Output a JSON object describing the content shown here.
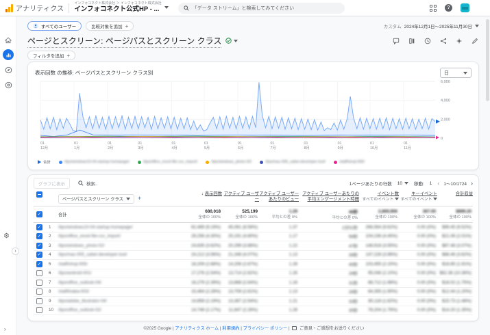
{
  "header": {
    "logo_text": "アナリティクス",
    "account_breadcrumb": "インフォコネクト株式会社  ＞  インフォコネクト株式会社",
    "property_name": "インフォコネクト公式HP - ...",
    "search_placeholder": "「データ ストリーム」と検索してみてください",
    "help_glyph": "?"
  },
  "toolbar": {
    "segment_chip": "すべてのユーザー",
    "add_comparison": "比較対象を追加",
    "add_plus": "+",
    "date_type": "カスタム",
    "date_range": "2024年12月1日～2025年11月30日"
  },
  "report": {
    "title": "ページとスクリーン: ページパスとスクリーン クラス",
    "add_filter": "フィルタを追加",
    "filter_plus": "+"
  },
  "chart_card": {
    "title": "表示回数 の推移: ページパスとスクリーン クラス別",
    "granularity": "日"
  },
  "chart_data": {
    "type": "line",
    "title": "表示回数 の推移: ページパスとスクリーン クラス別",
    "ylabel": "表示回数",
    "ylim": [
      0,
      6000
    ],
    "y_ticks": [
      "0",
      "2,000",
      "4,000",
      "6,000"
    ],
    "x_months": [
      {
        "day": 0,
        "top": "01",
        "label": "12月"
      },
      {
        "day": 31,
        "top": "01",
        "label": "1月"
      },
      {
        "day": 62,
        "top": "01",
        "label": "2月"
      },
      {
        "day": 90,
        "top": "01",
        "label": "3月"
      },
      {
        "day": 121,
        "top": "01",
        "label": "4月"
      },
      {
        "day": 151,
        "top": "01",
        "label": "5月"
      },
      {
        "day": 182,
        "top": "01",
        "label": "6月"
      },
      {
        "day": 212,
        "top": "01",
        "label": "7月"
      },
      {
        "day": 243,
        "top": "01",
        "label": "8月"
      },
      {
        "day": 274,
        "top": "01",
        "label": "9月"
      },
      {
        "day": 304,
        "top": "01",
        "label": "10月"
      },
      {
        "day": 335,
        "top": "01",
        "label": "11月"
      }
    ],
    "days_total": 364,
    "total_series": {
      "name": "合計",
      "color": "#7aabf8",
      "fill": "rgba(138,180,248,0.22)",
      "marker_color": "#1967d2",
      "values": [
        1900,
        950,
        2150,
        1000,
        2200,
        900,
        2050,
        1050,
        2100,
        1500,
        800,
        700,
        4750,
        2300,
        1100,
        2250,
        1000,
        2350,
        1050,
        2200,
        950,
        2300,
        1000,
        2250,
        1100,
        2350,
        950,
        2200,
        1050,
        2300,
        1000,
        2250,
        1100,
        2200,
        950,
        2300,
        1000,
        2150,
        1050,
        2250,
        1000,
        2200,
        950,
        2100,
        1000,
        2150,
        900,
        1800,
        850,
        1400,
        750,
        900,
        1600,
        2200,
        1000,
        2250,
        950,
        2300,
        1050,
        2200,
        1000,
        2300,
        1050,
        2250,
        1000,
        2300,
        1100,
        5900,
        2400,
        1100,
        2300,
        1000,
        2250,
        1050,
        2200,
        950,
        2150,
        1000,
        2100,
        900,
        2050,
        950,
        2000,
        900,
        1950,
        850,
        1700,
        800,
        1100,
        900,
        1600,
        850,
        1900,
        950,
        2000,
        4400,
        2100,
        1000,
        2150,
        950,
        2100,
        1000,
        2050,
        950,
        2100,
        1000,
        2150,
        900,
        2100,
        1000,
        2050,
        950,
        2100,
        1000,
        2050,
        950,
        2000,
        1000,
        2100,
        950,
        2050,
        1750
      ]
    },
    "series": [
      {
        "name": "/tips/windows10-04-startup-homepage/",
        "color": "#4285f4",
        "redacted": true,
        "values": [
          290,
          180,
          320,
          850,
          340,
          320,
          300,
          330,
          310,
          320,
          300,
          310,
          280,
          300,
          310,
          320,
          300,
          310,
          300,
          290,
          280,
          290,
          300,
          310,
          300,
          310,
          300,
          310,
          320,
          300,
          280
        ]
      },
      {
        "name": "/tips/office_excel-file-csv_import/",
        "color": "#34a853",
        "redacted": true,
        "values": [
          150,
          160,
          170,
          180,
          190,
          200,
          190,
          180,
          170,
          180,
          190,
          210,
          200,
          190,
          180,
          170,
          160,
          170,
          180,
          190,
          180,
          170,
          160,
          150,
          160,
          170,
          180,
          170,
          160,
          150,
          140
        ]
      },
      {
        "name": "/tips/windows_photo-02/",
        "color": "#f9ab00",
        "redacted": true,
        "values": [
          120,
          130,
          140,
          150,
          140,
          130,
          140,
          150,
          160,
          150,
          140,
          130,
          120,
          130,
          140,
          150,
          140,
          130,
          120,
          110,
          120,
          130,
          140,
          130,
          120,
          110,
          120,
          130,
          120,
          110,
          100
        ]
      },
      {
        "name": "/tips/mac-005_safari-developer-tool/",
        "color": "#3f51b5",
        "redacted": true,
        "values": [
          100,
          110,
          100,
          90,
          100,
          110,
          120,
          110,
          100,
          90,
          100,
          110,
          100,
          90,
          80,
          90,
          100,
          110,
          100,
          90,
          80,
          90,
          100,
          90,
          80,
          90,
          100,
          90,
          80,
          90,
          80
        ]
      },
      {
        "name": "/staff/shoji-005/",
        "color": "#e52592",
        "redacted": true,
        "values": [
          60,
          70,
          80,
          70,
          60,
          70,
          80,
          90,
          80,
          70,
          60,
          70,
          80,
          70,
          60,
          70,
          80,
          70,
          60,
          70,
          80,
          70,
          60,
          70,
          60,
          70,
          60,
          70,
          60,
          70,
          60
        ]
      }
    ],
    "legend_total_label": "合計"
  },
  "table": {
    "show_on_chart": "グラフに表示",
    "search_placeholder": "検索..",
    "dimension": "ページパスとスクリーン クラス",
    "sort_arrow": "↓",
    "columns": [
      {
        "label": "表示回数",
        "sub": "",
        "sorted": true
      },
      {
        "label": "アクティブ ユーザー",
        "sub": ""
      },
      {
        "label": "アクティブ ユーザーあたりのビュー",
        "sub": ""
      },
      {
        "label": "アクティブ ユーザーあたりの平均エンゲージメント時間",
        "sub": ""
      },
      {
        "label": "イベント数",
        "sub": "すべてのイベント"
      },
      {
        "label": "キーイベント",
        "sub": "すべてのイベント"
      },
      {
        "label": "合計収益",
        "sub": ""
      }
    ],
    "totals": {
      "label": "合計",
      "cells": [
        {
          "v": "680,018",
          "s": "全体の 100%",
          "redact": false
        },
        {
          "v": "525,199",
          "s": "全体の 100%",
          "redact": false
        },
        {
          "v": "1.29",
          "s": "平均との差 0%",
          "redact": true
        },
        {
          "v": "46秒",
          "s": "平均との差 0%",
          "redact": true
        },
        {
          "v": "2,869,906",
          "s": "全体の 100%",
          "redact": true
        },
        {
          "v": "367.00",
          "s": "全体の 100%",
          "redact": true
        },
        {
          "v": "$899.20",
          "s": "全体の 100%",
          "redact": true
        }
      ]
    },
    "rows": [
      {
        "rank": "1",
        "checked": true,
        "path": "/tips/windows10-04-startup-homepage/",
        "cells": [
          "62,489 (9.19%)",
          "45,061 (8.58%)",
          "1.37",
          "1分51秒",
          "266,564 (9.62%)",
          "0.00 (0%)",
          "$99.45 (9.52%)"
        ]
      },
      {
        "rank": "2",
        "checked": true,
        "path": "/tips/office_excel-file-csv_import/",
        "cells": [
          "29,256 (4.30%)",
          "25,191 (4.80%)",
          "1.17",
          "56秒",
          "104,236 (4.45%)",
          "0.00 (0%)",
          "$21.06 (2.01%)"
        ]
      },
      {
        "rank": "3",
        "checked": true,
        "path": "/tips/windows_photo-02/",
        "cells": [
          "24,635 (3.62%)",
          "20,299 (3.86%)",
          "1.22",
          "47秒",
          "148,918 (3.55%)",
          "0.00 (0%)",
          "$87.48 (3.07%)"
        ]
      },
      {
        "rank": "4",
        "checked": true,
        "path": "/tips/mac-005_safari-developer-tool/",
        "cells": [
          "24,212 (3.56%)",
          "21,346 (4.07%)",
          "1.13",
          "39秒",
          "147,228 (3.96%)",
          "0.00 (0%)",
          "$88.46 (3.62%)"
        ]
      },
      {
        "rank": "5",
        "checked": true,
        "path": "/staff/shoji-005/",
        "cells": [
          "18,209 (2.68%)",
          "14,206 (2.67%)",
          "1.28",
          "45秒",
          "103,455 (2.15%)",
          "0.00 (0%)",
          "$16.85 (1.91%)"
        ]
      },
      {
        "rank": "6",
        "checked": false,
        "path": "/tips/android-001/",
        "cells": [
          "17,276 (2.54%)",
          "13,714 (2.62%)",
          "1.26",
          "29秒",
          "95,046 (2.10%)",
          "0.00 (0%)",
          "$62.36 (10.36%)"
        ]
      },
      {
        "rank": "7",
        "checked": false,
        "path": "/tips/office_outlook-04/",
        "cells": [
          "16,279 (2.39%)",
          "13,868 (2.64%)",
          "1.16",
          "31秒",
          "88,712 (1.98%)",
          "0.00 (0%)",
          "$18.02 (1.75%)"
        ]
      },
      {
        "rank": "8",
        "checked": false,
        "path": "/staff/inaba-003/",
        "cells": [
          "15,464 (2.28%)",
          "13,709 (2.61%)",
          "1.13",
          "26秒",
          "84,355 (1.90%)",
          "0.00 (0%)",
          "$12.44 (1.20%)"
        ]
      },
      {
        "rank": "9",
        "checked": false,
        "path": "/tips/adobe_illustrator-04/",
        "cells": [
          "14,858 (2.19%)",
          "13,367 (2.54%)",
          "1.21",
          "33秒",
          "80,118 (1.82%)",
          "0.00 (0%)",
          "$15.73 (1.48%)"
        ]
      },
      {
        "rank": "10",
        "checked": false,
        "path": "/tips/office_outlook-02/",
        "cells": [
          "14,748 (2.17%)",
          "11,847 (2.26%)",
          "1.28",
          "35秒",
          "78,204 (1.76%)",
          "0.00 (0%)",
          "$14.20 (1.35%)"
        ]
      }
    ],
    "rows_redacted": true
  },
  "pagination": {
    "rows_label": "1ページあたりの行数",
    "rows_value": "10",
    "goto_label": "移動:",
    "goto_value": "1",
    "range": "1～10/1724",
    "prev": "‹",
    "next": "›"
  },
  "footer": {
    "copyright": "©2025 Google |",
    "link_home": "アナリティクス ホーム",
    "sep1": "|",
    "link_terms": "利用規約",
    "sep2": "|",
    "link_privacy": "プライバシー ポリシー",
    "sep3": "|",
    "feedback": "ご意見・ご感想をお送りください"
  }
}
